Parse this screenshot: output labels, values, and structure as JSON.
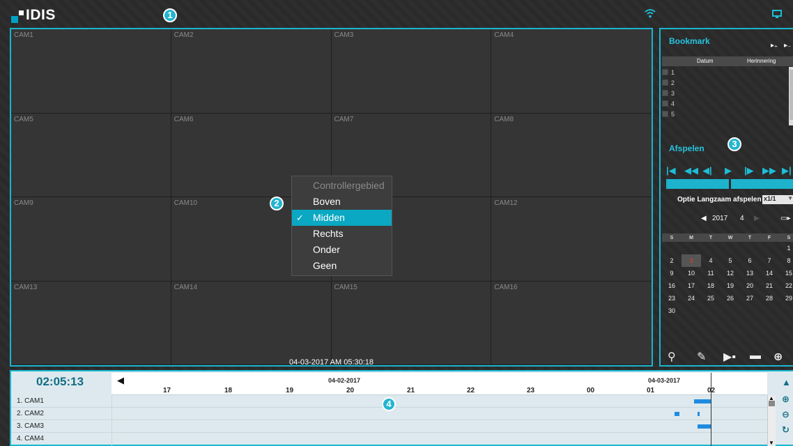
{
  "app": {
    "logo_text": "IDIS"
  },
  "badges": {
    "b1": "1",
    "b2": "2",
    "b3": "3",
    "b4": "4"
  },
  "grid": {
    "cameras": [
      "CAM1",
      "CAM2",
      "CAM3",
      "CAM4",
      "CAM5",
      "CAM6",
      "CAM7",
      "CAM8",
      "CAM9",
      "CAM10",
      "",
      "CAM12",
      "CAM13",
      "CAM14",
      "CAM15",
      "CAM16"
    ],
    "datetime": "04-03-2017  AM 05:30:18"
  },
  "context_menu": {
    "title": "Controllergebied",
    "items": [
      "Boven",
      "Midden",
      "Rechts",
      "Onder",
      "Geen"
    ],
    "selected": "Midden"
  },
  "bookmark": {
    "title": "Bookmark",
    "col_date": "Datum",
    "col_memo": "Herinnering",
    "rows": [
      "1",
      "2",
      "3",
      "4",
      "5"
    ]
  },
  "playback": {
    "title": "Afspelen",
    "slow_label": "Optie Langzaam afspelen",
    "slow_value": "x1/1"
  },
  "calendar": {
    "year": "2017",
    "month": "4",
    "dow": [
      "S",
      "M",
      "T",
      "W",
      "T",
      "F",
      "S"
    ],
    "weeks": [
      [
        "",
        "",
        "",
        "",
        "",
        "",
        "1"
      ],
      [
        "2",
        "3",
        "4",
        "5",
        "6",
        "7",
        "8"
      ],
      [
        "9",
        "10",
        "11",
        "12",
        "13",
        "14",
        "15"
      ],
      [
        "16",
        "17",
        "18",
        "19",
        "20",
        "21",
        "22"
      ],
      [
        "23",
        "24",
        "25",
        "26",
        "27",
        "28",
        "29"
      ],
      [
        "30",
        "",
        "",
        "",
        "",
        "",
        ""
      ]
    ],
    "today": "3"
  },
  "timeline": {
    "current_time": "02:05:13",
    "date_left": "04-02-2017",
    "date_right": "04-03-2017",
    "ticks": [
      "17",
      "18",
      "19",
      "20",
      "21",
      "22",
      "23",
      "00",
      "01",
      "02"
    ],
    "channels": [
      "1. CAM1",
      "2. CAM2",
      "3. CAM3",
      "4. CAM4"
    ]
  },
  "colors": {
    "accent": "#19b6cf",
    "record": "#1f8be0",
    "today": "#e0451a"
  }
}
